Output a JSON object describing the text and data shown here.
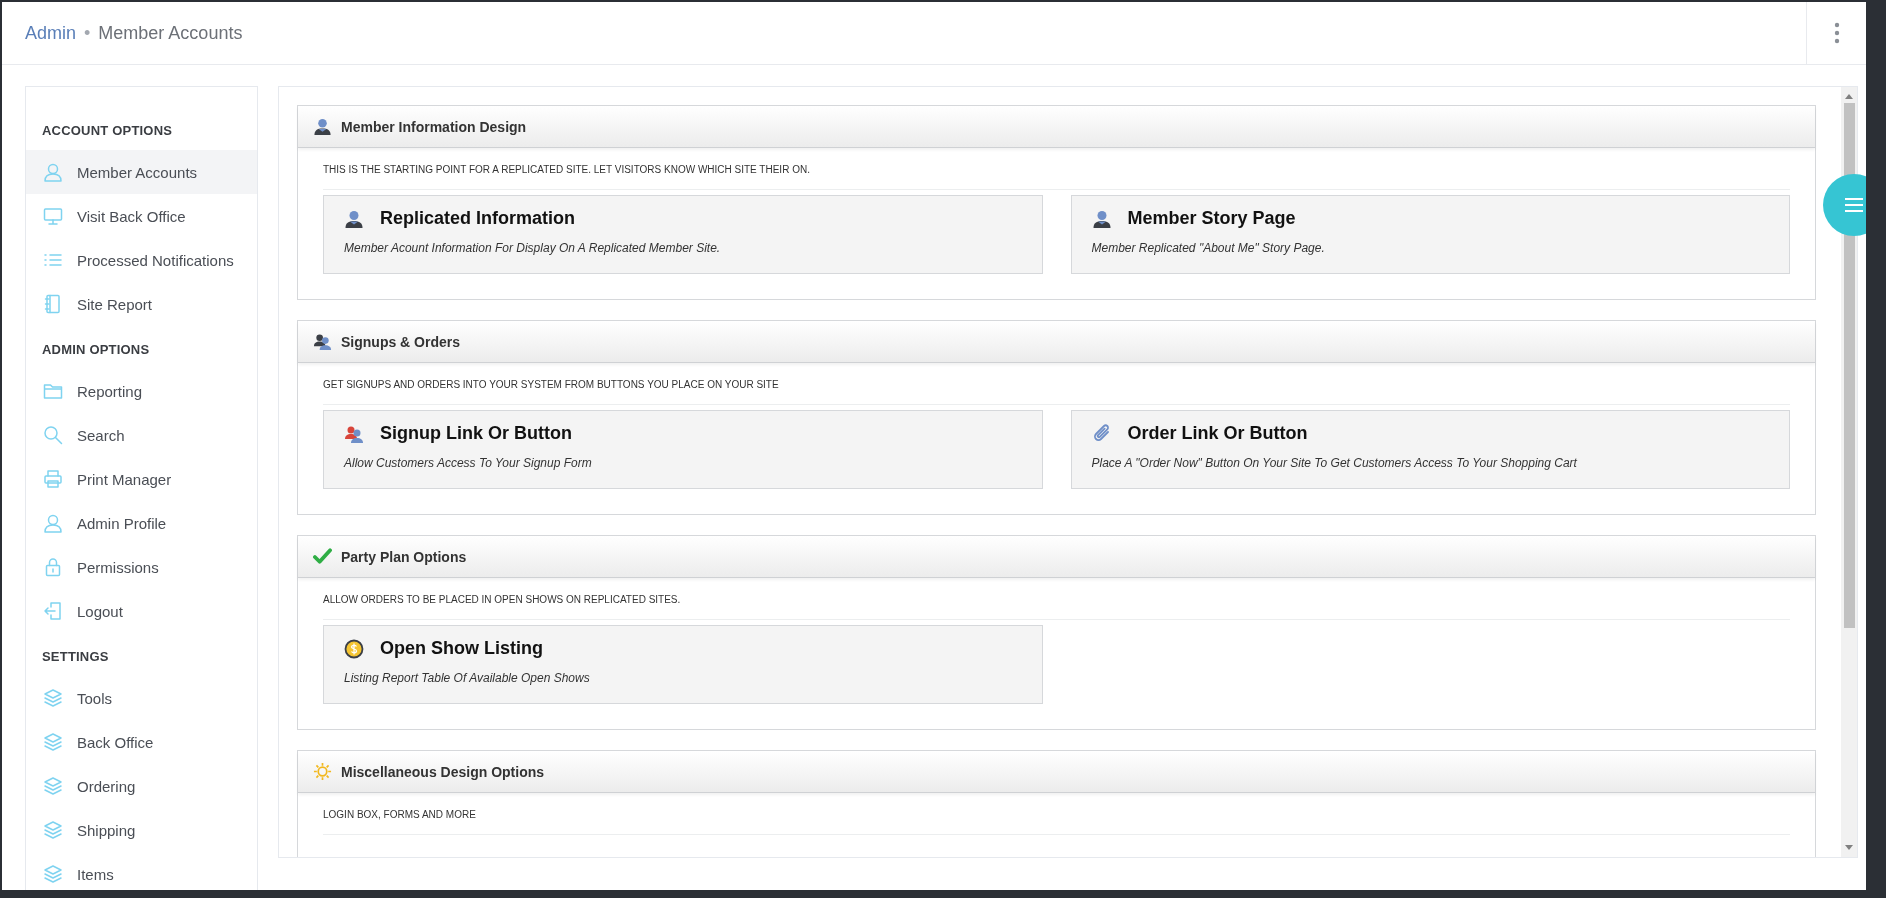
{
  "breadcrumb": {
    "root": "Admin",
    "separator": "•",
    "current": "Member Accounts"
  },
  "sidebar": {
    "groups": [
      {
        "title": "ACCOUNT OPTIONS",
        "items": [
          {
            "label": "Member Accounts",
            "kind": "user",
            "selected": true
          },
          {
            "label": "Visit Back Office",
            "kind": "monitor",
            "selected": false
          },
          {
            "label": "Processed Notifications",
            "kind": "list",
            "selected": false
          },
          {
            "label": "Site Report",
            "kind": "notebook",
            "selected": false
          }
        ]
      },
      {
        "title": "ADMIN OPTIONS",
        "items": [
          {
            "label": "Reporting",
            "kind": "folder",
            "selected": false
          },
          {
            "label": "Search",
            "kind": "search",
            "selected": false
          },
          {
            "label": "Print Manager",
            "kind": "printer",
            "selected": false
          },
          {
            "label": "Admin Profile",
            "kind": "user",
            "selected": false
          },
          {
            "label": "Permissions",
            "kind": "lock",
            "selected": false
          },
          {
            "label": "Logout",
            "kind": "logout",
            "selected": false
          }
        ]
      },
      {
        "title": "SETTINGS",
        "items": [
          {
            "label": "Tools",
            "kind": "layers",
            "selected": false
          },
          {
            "label": "Back Office",
            "kind": "layers",
            "selected": false
          },
          {
            "label": "Ordering",
            "kind": "layers",
            "selected": false
          },
          {
            "label": "Shipping",
            "kind": "layers",
            "selected": false
          },
          {
            "label": "Items",
            "kind": "layers",
            "selected": false
          }
        ]
      }
    ]
  },
  "sections": [
    {
      "title": "Member Information Design",
      "kind": "person",
      "description": "THIS IS THE STARTING POINT FOR A REPLICATED SITE. LET VISITORS KNOW WHICH SITE THEIR ON.",
      "cards": [
        {
          "title": "Replicated Information",
          "kind": "person",
          "description": "Member Acount Information For Display On A Replicated Member Site."
        },
        {
          "title": "Member Story Page",
          "kind": "person",
          "description": "Member Replicated \"About Me\" Story Page."
        }
      ]
    },
    {
      "title": "Signups & Orders",
      "kind": "people",
      "description": "GET SIGNUPS AND ORDERS INTO YOUR SYSTEM FROM BUTTONS YOU PLACE ON YOUR SITE",
      "cards": [
        {
          "title": "Signup Link Or Button",
          "kind": "people-red",
          "description": "Allow Customers Access To Your Signup Form"
        },
        {
          "title": "Order Link Or Button",
          "kind": "paperclip",
          "description": "Place A \"Order Now\" Button On Your Site To Get Customers Access To Your Shopping Cart"
        }
      ]
    },
    {
      "title": "Party Plan Options",
      "kind": "check",
      "description": "ALLOW ORDERS TO BE PLACED IN OPEN SHOWS ON REPLICATED SITES.",
      "cards": [
        {
          "title": "Open Show Listing",
          "kind": "coin",
          "description": "Listing Report Table Of Available Open Shows"
        }
      ]
    },
    {
      "title": "Miscellaneous Design Options",
      "kind": "sun",
      "description": "LOGIN BOX, FORMS AND MORE"
    }
  ]
}
